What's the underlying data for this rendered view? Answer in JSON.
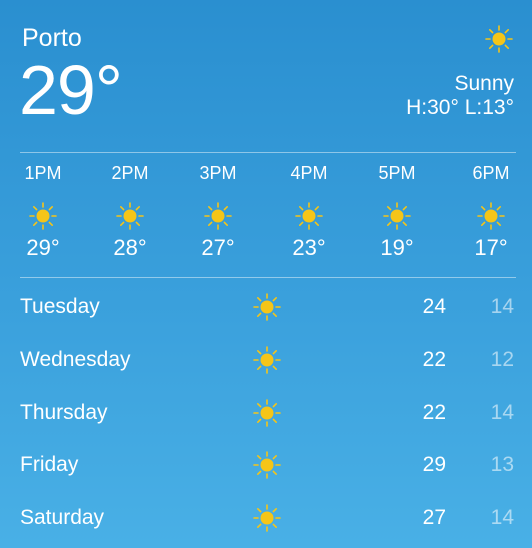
{
  "current": {
    "city": "Porto",
    "temperature": "29°",
    "condition": "Sunny",
    "hi_lo": "H:30° L:13°",
    "icon": "sun-icon"
  },
  "hourly": [
    {
      "time": "1PM",
      "temp": "29°",
      "icon": "sun-icon"
    },
    {
      "time": "2PM",
      "temp": "28°",
      "icon": "sun-icon"
    },
    {
      "time": "3PM",
      "temp": "27°",
      "icon": "sun-icon"
    },
    {
      "time": "4PM",
      "temp": "23°",
      "icon": "sun-icon"
    },
    {
      "time": "5PM",
      "temp": "19°",
      "icon": "sun-icon"
    },
    {
      "time": "6PM",
      "temp": "17°",
      "icon": "sun-icon"
    }
  ],
  "daily": [
    {
      "day": "Tuesday",
      "high": "24",
      "low": "14",
      "icon": "sun-icon"
    },
    {
      "day": "Wednesday",
      "high": "22",
      "low": "12",
      "icon": "sun-icon"
    },
    {
      "day": "Thursday",
      "high": "22",
      "low": "14",
      "icon": "sun-icon"
    },
    {
      "day": "Friday",
      "high": "29",
      "low": "13",
      "icon": "sun-icon"
    },
    {
      "day": "Saturday",
      "high": "27",
      "low": "14",
      "icon": "sun-icon"
    }
  ],
  "colors": {
    "background_top": "#2a8fd0",
    "background_bottom": "#49b0e6",
    "sun": "#f5c518",
    "text": "#ffffff"
  }
}
